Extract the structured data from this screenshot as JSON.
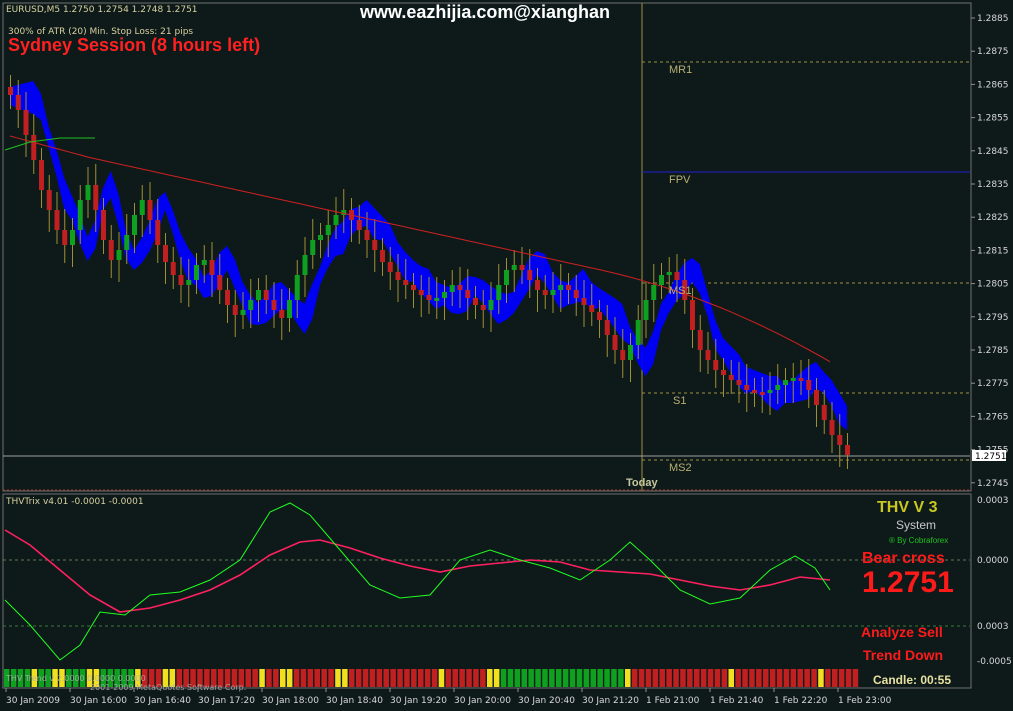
{
  "header": {
    "symbol_line": "EURUSD,M5  1.2750 1.2754 1.2748 1.2751",
    "atr_line": "300% of ATR (20)     Min. Stop Loss:   21 pips",
    "watermark": "www.eazhijia.com@xianghan",
    "session": "Sydney Session (8 hours left)"
  },
  "price_axis": {
    "ticks": [
      "1.2885",
      "1.2875",
      "1.2865",
      "1.2855",
      "1.2845",
      "1.2835",
      "1.2825",
      "1.2815",
      "1.2805",
      "1.2795",
      "1.2785",
      "1.2775",
      "1.2765",
      "1.2755",
      "1.2745"
    ],
    "current_price": "1.2751"
  },
  "levels": {
    "mr1": "MR1",
    "fpv": "FPV",
    "ms1": "MS1",
    "s1": "S1",
    "ms2": "MS2",
    "today": "Today"
  },
  "indicator": {
    "label": "THVTrix v4.01 -0.0001 -0.0001",
    "axis": [
      "0.0003",
      "0.0000",
      "0.0003",
      "-0.0005"
    ],
    "thv_title": "THV V 3",
    "thv_system": "System",
    "thv_by": "® By Cobraforex",
    "bear_cross": "Bear cross",
    "bear_price": "1.2751",
    "analyze": "Analyze Sell",
    "trend": "Trend Down",
    "candle": "Candle:  00:55",
    "footer_text": "THV Trend v 2.0000 0.0000 0.0000",
    "copyright": "2001-2009 MetaQuotes Software Corp."
  },
  "time_axis": {
    "labels": [
      "30 Jan 2009",
      "30 Jan 16:00",
      "30 Jan 16:40",
      "30 Jan 17:20",
      "30 Jan 18:00",
      "30 Jan 18:40",
      "30 Jan 19:20",
      "30 Jan 20:00",
      "30 Jan 20:40",
      "30 Jan 21:20",
      "1 Feb 21:00",
      "1 Feb 21:40",
      "1 Feb 22:20",
      "1 Feb 23:00"
    ]
  },
  "colors": {
    "background": "#0e1a1a",
    "bull": "#10a020",
    "bear": "#c02020",
    "cloud": "#0000ff",
    "ma": "#d02020",
    "trix_fast": "#20ff20",
    "trix_slow": "#ff2060",
    "level_line": "#a09040",
    "fpv_line": "#2020d0"
  }
}
